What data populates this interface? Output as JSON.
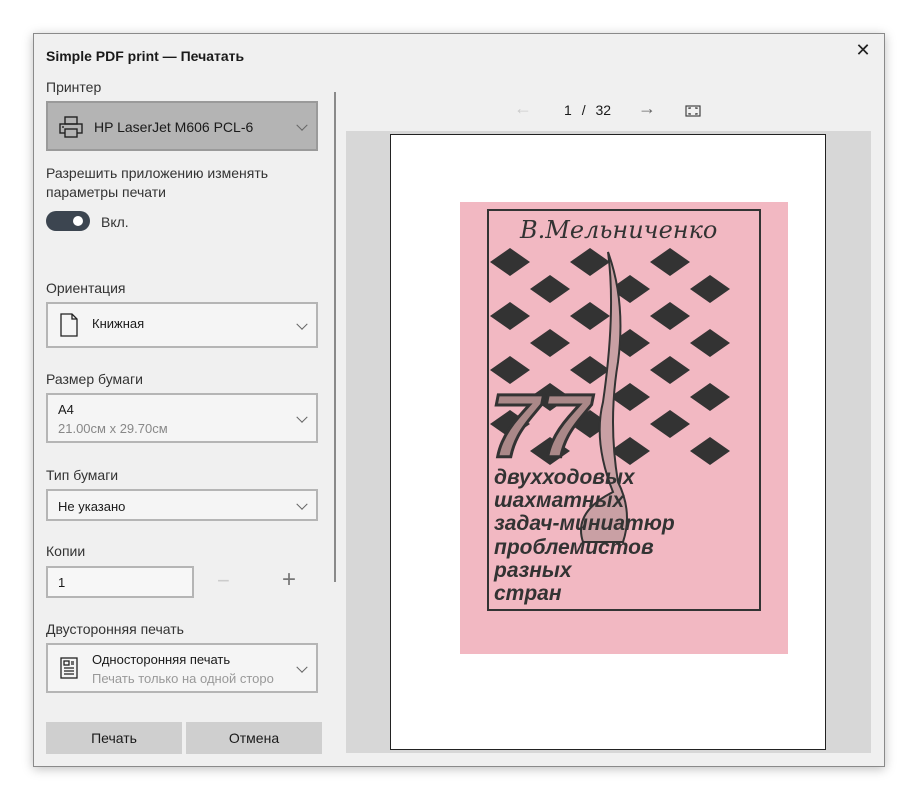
{
  "window": {
    "title": "Simple PDF print — Печатать",
    "close_label": "✕"
  },
  "printer": {
    "label": "Принтер",
    "value": "HP LaserJet M606 PCL-6"
  },
  "allow_change": {
    "label": "Разрешить приложению изменять параметры печати",
    "toggle_state": "Вкл.",
    "on": true
  },
  "orientation": {
    "label": "Ориентация",
    "value": "Книжная"
  },
  "paper_size": {
    "label": "Размер бумаги",
    "value": "A4",
    "sub": "21.00см x 29.70см"
  },
  "paper_type": {
    "label": "Тип бумаги",
    "value": "Не указано"
  },
  "copies": {
    "label": "Копии",
    "value": "1",
    "minus": "−",
    "plus": "+"
  },
  "duplex": {
    "label": "Двусторонняя печать",
    "value": "Односторонняя печать",
    "sub": "Печать только на одной сторо"
  },
  "buttons": {
    "print": "Печать",
    "cancel": "Отмена"
  },
  "pager": {
    "current": "1",
    "separator": "/",
    "total": "32"
  },
  "cover": {
    "author": "В.Мельниченко",
    "number": "77",
    "lines": [
      "двухходовых",
      "шахматных",
      "задач-миниатюр",
      "проблемистов",
      "разных",
      "стран"
    ],
    "bg": "#f2b8c2"
  }
}
